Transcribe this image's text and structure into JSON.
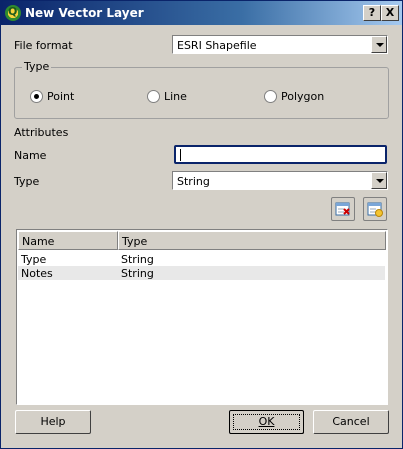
{
  "window": {
    "title": "New Vector Layer"
  },
  "titlebar_buttons": {
    "help": "?",
    "close": "X"
  },
  "file_format": {
    "label": "File format",
    "value": "ESRI Shapefile"
  },
  "geometry_type": {
    "legend": "Type",
    "options": [
      {
        "label": "Point",
        "checked": true
      },
      {
        "label": "Line",
        "checked": false
      },
      {
        "label": "Polygon",
        "checked": false
      }
    ]
  },
  "attributes": {
    "heading": "Attributes",
    "name_label": "Name",
    "name_value": "",
    "type_label": "Type",
    "type_value": "String"
  },
  "table": {
    "columns": [
      "Name",
      "Type"
    ],
    "rows": [
      {
        "name": "Type",
        "type": "String"
      },
      {
        "name": "Notes",
        "type": "String"
      }
    ]
  },
  "buttons": {
    "help": "Help",
    "ok": "OK",
    "cancel": "Cancel"
  },
  "colors": {
    "titlebar": "#0a246a",
    "face": "#d4d0c8",
    "focus": "#0a246a"
  },
  "icons": {
    "remove_attribute": "delete-attribute-icon",
    "add_attribute": "add-attribute-icon"
  }
}
